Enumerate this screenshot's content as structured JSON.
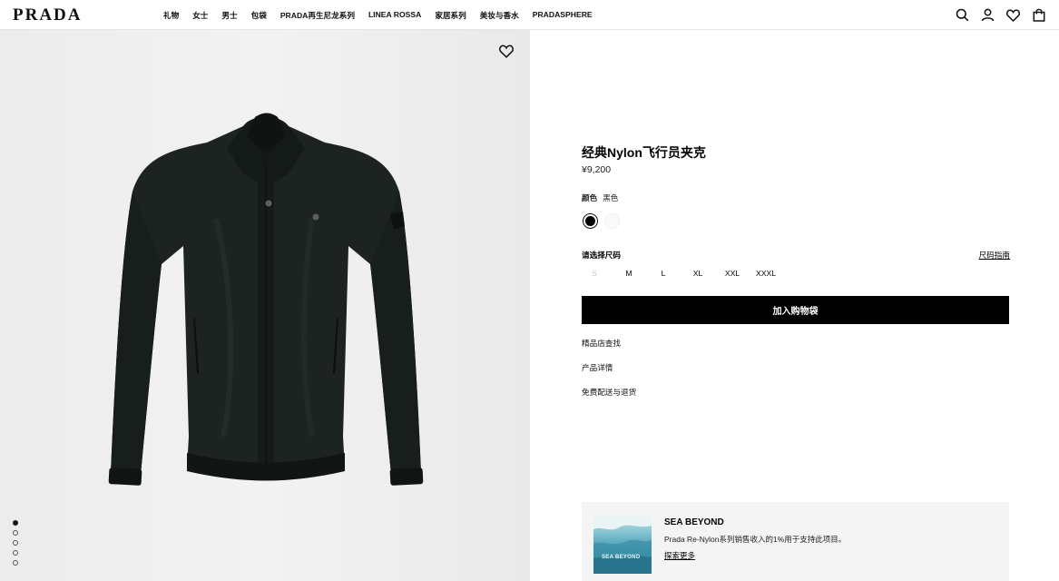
{
  "header": {
    "logo": "PRADA",
    "nav": [
      "礼物",
      "女士",
      "男士",
      "包袋",
      "PRADA再生尼龙系列",
      "LINEA ROSSA",
      "家居系列",
      "美妆与香水",
      "PRADASPHERE"
    ],
    "icons": [
      "search-icon",
      "account-icon",
      "wishlist-icon",
      "bag-icon"
    ]
  },
  "gallery": {
    "image": "black nylon bomber jacket on grey background",
    "dots_count": 5,
    "active_dot": 0
  },
  "product": {
    "title": "经典Nylon飞行员夹克",
    "price": "¥9,200",
    "color_label": "颜色",
    "color_value": "黑色",
    "swatches": [
      "#000000",
      "#ffffff"
    ],
    "size_label": "请选择尺码",
    "size_guide": "尺码指南",
    "sizes": [
      {
        "label": "S",
        "available": false
      },
      {
        "label": "M",
        "available": true
      },
      {
        "label": "L",
        "available": true
      },
      {
        "label": "XL",
        "available": true
      },
      {
        "label": "XXL",
        "available": true
      },
      {
        "label": "XXXL",
        "available": true
      }
    ],
    "add_to_bag": "加入购物袋",
    "links": [
      "精品店查找",
      "产品详情",
      "免费配送与退货"
    ]
  },
  "sea_beyond": {
    "image_text": "SEA BEYOND",
    "title": "SEA BEYOND",
    "description": "Prada Re-Nylon系列销售收入的1%用于支持此项目。",
    "more": "探索更多"
  }
}
